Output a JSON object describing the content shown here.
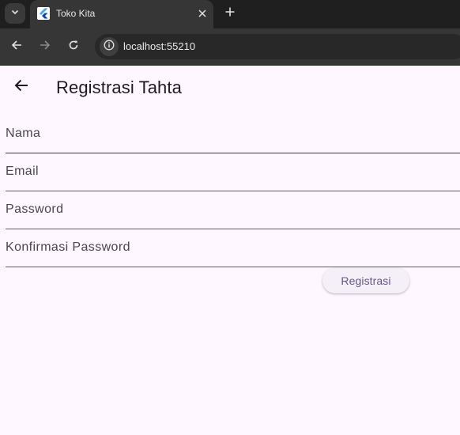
{
  "browser": {
    "tab_title": "Toko Kita",
    "url": "localhost:55210"
  },
  "app": {
    "title": "Registrasi Tahta",
    "fields": {
      "name_label": "Nama",
      "email_label": "Email",
      "password_label": "Password",
      "confirm_label": "Konfirmasi Password"
    },
    "register_label": "Registrasi"
  },
  "colors": {
    "background": "#fef7ff",
    "accent": "#65558f",
    "chrome": "#363636"
  }
}
